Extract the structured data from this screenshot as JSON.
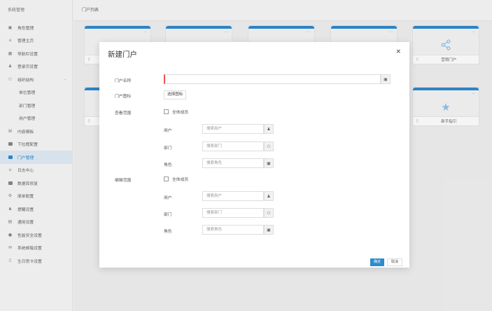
{
  "sidebar": {
    "title": "系统管理",
    "items": [
      {
        "label": "角色管理",
        "icon": "role-icon"
      },
      {
        "label": "管理主页",
        "icon": "home-icon"
      },
      {
        "label": "导航栏设置",
        "icon": "nav-icon"
      },
      {
        "label": "登录页设置",
        "icon": "login-icon"
      },
      {
        "label": "组织结构",
        "icon": "org-icon",
        "expanded": true
      },
      {
        "label": "单位管理",
        "sub": true
      },
      {
        "label": "部门管理",
        "sub": true
      },
      {
        "label": "用户管理",
        "sub": true
      },
      {
        "label": "内容模板",
        "icon": "template-icon"
      },
      {
        "label": "下拉框配置",
        "icon": "dropdown-icon"
      },
      {
        "label": "门户管理",
        "icon": "portal-icon",
        "active": true
      },
      {
        "label": "日志中心",
        "icon": "log-icon"
      },
      {
        "label": "数据库修复",
        "icon": "database-icon"
      },
      {
        "label": "简单配置",
        "icon": "config-icon"
      },
      {
        "label": "提醒设置",
        "icon": "reminder-icon"
      },
      {
        "label": "通用设置",
        "icon": "general-icon"
      },
      {
        "label": "性能安全设置",
        "icon": "security-icon"
      },
      {
        "label": "系统邮箱设置",
        "icon": "mail-icon"
      },
      {
        "label": "生日贺卡设置",
        "icon": "birthday-icon"
      }
    ]
  },
  "main": {
    "header": "门户列表",
    "cards": [
      {
        "name": "营销门户",
        "icon": "share-icon"
      },
      {
        "name": "新手指引",
        "icon": "star-icon"
      }
    ]
  },
  "modal": {
    "title": "新建门户",
    "close": "×",
    "name_label": "门户名称",
    "name_value": "",
    "icon_label": "门户图标",
    "icon_button": "选择图标",
    "view_label": "查看范围",
    "edit_label": "编辑范围",
    "all_members": "全体成员",
    "user_label": "用户",
    "dept_label": "部门",
    "role_label": "角色",
    "user_placeholder": "搜索用户",
    "dept_placeholder": "搜索部门",
    "role_placeholder": "搜索角色",
    "confirm": "确定",
    "cancel": "取消"
  },
  "colors": {
    "accent": "#2d8ad0",
    "required": "#e65050"
  }
}
